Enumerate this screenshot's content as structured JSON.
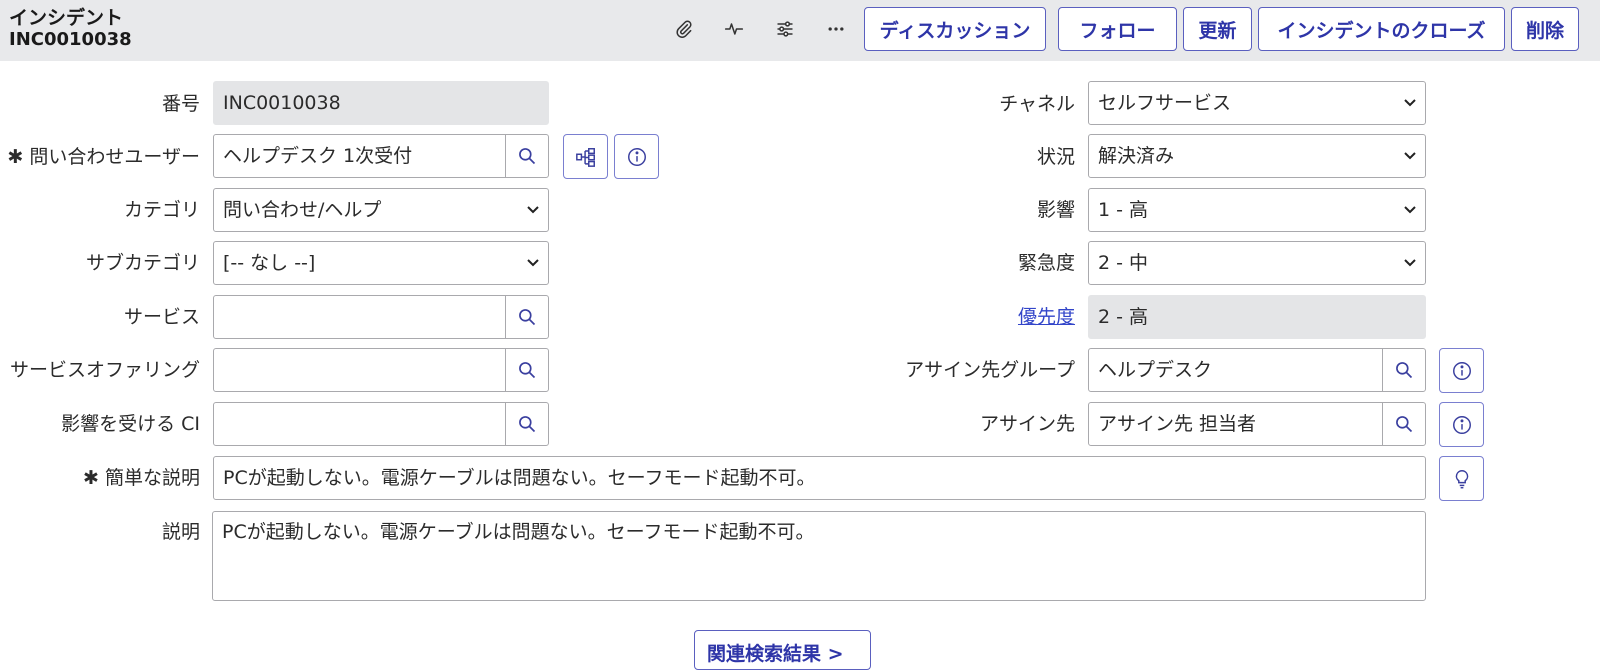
{
  "header": {
    "title": "インシデント",
    "number": "INC0010038",
    "buttons": {
      "discussion": "ディスカッション",
      "follow": "フォロー",
      "update": "更新",
      "close": "インシデントのクローズ",
      "delete": "削除"
    },
    "icons": [
      "paperclip-icon",
      "activity-icon",
      "settings-sliders-icon",
      "more-icon"
    ]
  },
  "form": {
    "number": {
      "label": "番号",
      "value": "INC0010038"
    },
    "caller": {
      "label": "問い合わせユーザー",
      "required_mark": "✱",
      "value": "ヘルプデスク 1次受付"
    },
    "category": {
      "label": "カテゴリ",
      "value": "問い合わせ/ヘルプ"
    },
    "subcategory": {
      "label": "サブカテゴリ",
      "value": "[-- なし --]"
    },
    "service": {
      "label": "サービス",
      "value": ""
    },
    "service_offering": {
      "label": "サービスオファリング",
      "value": ""
    },
    "affected_ci": {
      "label": "影響を受ける CI",
      "value": ""
    },
    "channel": {
      "label": "チャネル",
      "value": "セルフサービス"
    },
    "state": {
      "label": "状況",
      "value": "解決済み"
    },
    "impact": {
      "label": "影響",
      "value": "1 - 高"
    },
    "urgency": {
      "label": "緊急度",
      "value": "2 - 中"
    },
    "priority": {
      "label": "優先度",
      "value": "2 - 高"
    },
    "assignment_group": {
      "label": "アサイン先グループ",
      "value": "ヘルプデスク"
    },
    "assigned_to": {
      "label": "アサイン先",
      "value": "アサイン先 担当者"
    },
    "short_description": {
      "label": "簡単な説明",
      "required_mark": "✱",
      "value": "PCが起動しない。電源ケーブルは問題ない。セーフモード起動不可。"
    },
    "description": {
      "label": "説明",
      "value": "PCが起動しない。電源ケーブルは問題ない。セーフモード起動不可。"
    },
    "related_search_label": "関連検索結果 >"
  },
  "colors": {
    "accent": "#2e35a8",
    "header_bg": "#e8e9eb",
    "readonly_bg": "#e4e5e7",
    "link": "#3245c9"
  }
}
